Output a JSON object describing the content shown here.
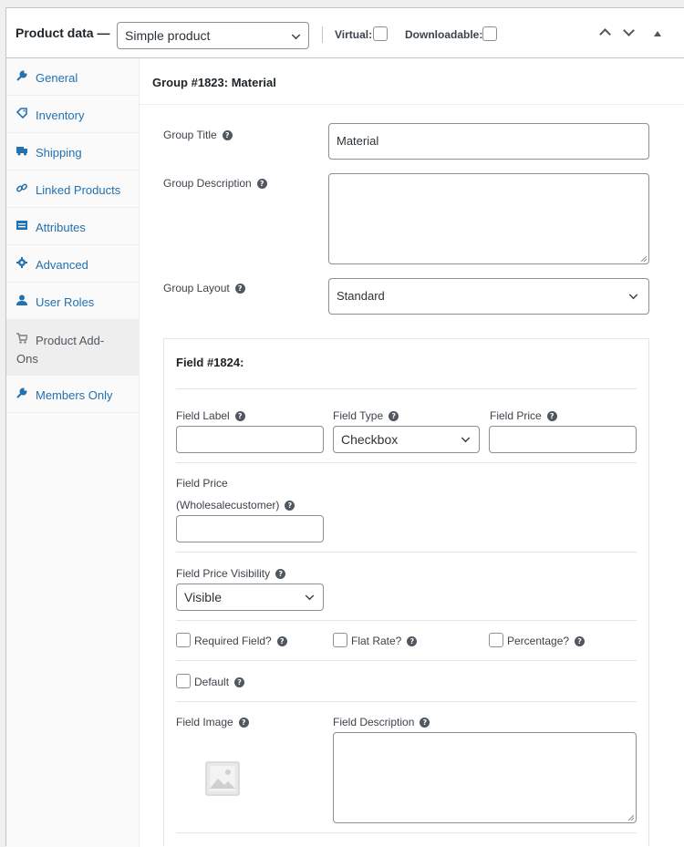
{
  "header": {
    "title": "Product data —",
    "product_type": "Simple product",
    "virtual_label": "Virtual:",
    "downloadable_label": "Downloadable:"
  },
  "sidebar": {
    "items": [
      {
        "label": "General",
        "icon": "wrench-icon"
      },
      {
        "label": "Inventory",
        "icon": "tag-icon"
      },
      {
        "label": "Shipping",
        "icon": "truck-icon"
      },
      {
        "label": "Linked Products",
        "icon": "link-icon"
      },
      {
        "label": "Attributes",
        "icon": "list-icon"
      },
      {
        "label": "Advanced",
        "icon": "gear-icon"
      },
      {
        "label": "User Roles",
        "icon": "user-icon"
      },
      {
        "label": "Product Add-",
        "label2": "Ons",
        "icon": "cart-icon",
        "active": true
      },
      {
        "label": "Members Only",
        "icon": "wrench-icon"
      }
    ]
  },
  "group": {
    "heading": "Group #1823: Material",
    "title_label": "Group Title",
    "title_value": "Material",
    "description_label": "Group Description",
    "description_value": "",
    "layout_label": "Group Layout",
    "layout_value": "Standard"
  },
  "field": {
    "heading": "Field #1824:",
    "label_label": "Field Label",
    "label_value": "",
    "type_label": "Field Type",
    "type_value": "Checkbox",
    "price_label": "Field Price",
    "price_value": "",
    "wholesale_label_1": "Field Price",
    "wholesale_label_2": "(Wholesalecustomer)",
    "wholesale_value": "",
    "visibility_label": "Field Price Visibility",
    "visibility_value": "Visible",
    "required_label": "Required Field?",
    "flat_rate_label": "Flat Rate?",
    "percentage_label": "Percentage?",
    "default_label": "Default",
    "image_label": "Field Image",
    "description_label": "Field Description",
    "description_value": ""
  },
  "colors": {
    "link": "#2271b1",
    "border": "#8c8f94",
    "help_icon": "#50575e"
  }
}
